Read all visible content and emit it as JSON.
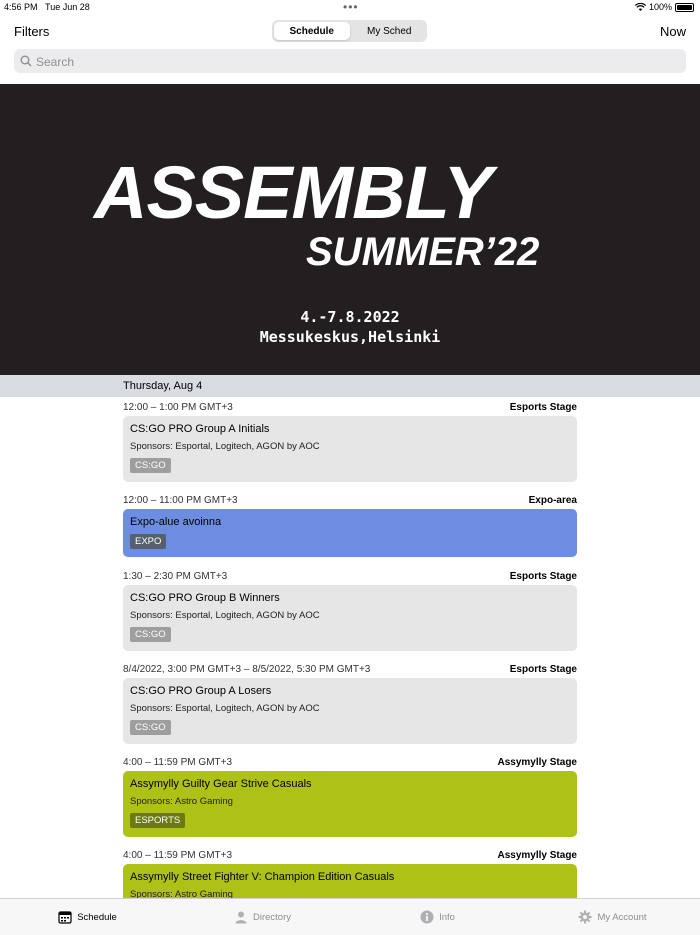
{
  "status": {
    "time": "4:56 PM",
    "date": "Tue Jun 28",
    "battery": "100%"
  },
  "nav": {
    "filters": "Filters",
    "now": "Now",
    "segments": [
      "Schedule",
      "My Sched"
    ]
  },
  "search": {
    "placeholder": "Search"
  },
  "banner": {
    "logo_main": "ASSEMBLY",
    "logo_sub": "SUMMER’22",
    "dates": "4.-7.8.2022",
    "venue": "Messukeskus,Helsinki"
  },
  "day": "Thursday, Aug 4",
  "events": [
    {
      "time": "12:00 – 1:00 PM GMT+3",
      "location": "Esports Stage",
      "title": "CS:GO PRO Group A Initials",
      "sponsors": "Sponsors: Esportal, Logitech, AGON by AOC",
      "tag": "CS:GO",
      "color": "#e6e6e6"
    },
    {
      "time": "12:00 – 11:00 PM GMT+3",
      "location": "Expo-area",
      "title": "Expo-alue avoinna",
      "sponsors": "",
      "tag": "EXPO",
      "color": "#6d8ee0"
    },
    {
      "time": "1:30 – 2:30 PM GMT+3",
      "location": "Esports Stage",
      "title": "CS:GO PRO Group B Winners",
      "sponsors": "Sponsors: Esportal, Logitech, AGON by AOC",
      "tag": "CS:GO",
      "color": "#e6e6e6"
    },
    {
      "time": "8/4/2022, 3:00 PM GMT+3 – 8/5/2022, 5:30 PM GMT+3",
      "location": "Esports Stage",
      "title": "CS:GO PRO Group A Losers",
      "sponsors": "Sponsors: Esportal, Logitech, AGON by AOC",
      "tag": "CS:GO",
      "color": "#e6e6e6"
    },
    {
      "time": "4:00 – 11:59 PM GMT+3",
      "location": "Assymylly Stage",
      "title": "Assymylly Guilty Gear Strive Casuals",
      "sponsors": "Sponsors: Astro Gaming",
      "tag": "ESPORTS",
      "color": "#aec117"
    },
    {
      "time": "4:00 – 11:59 PM GMT+3",
      "location": "Assymylly Stage",
      "title": "Assymylly Street Fighter V: Champion Edition Casuals",
      "sponsors": "Sponsors: Astro Gaming",
      "tag": "",
      "color": "#aec117"
    }
  ],
  "tabs": [
    {
      "label": "Schedule",
      "icon": "calendar-icon"
    },
    {
      "label": "Directory",
      "icon": "person-icon"
    },
    {
      "label": "Info",
      "icon": "info-icon"
    },
    {
      "label": "My Account",
      "icon": "gear-icon"
    }
  ]
}
